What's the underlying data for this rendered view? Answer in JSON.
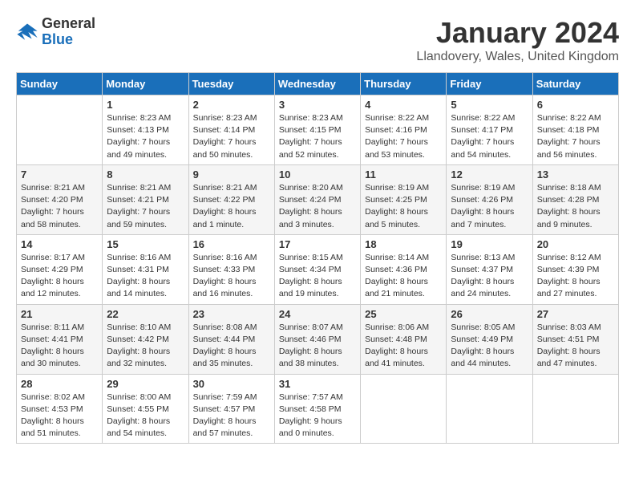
{
  "header": {
    "logo_general": "General",
    "logo_blue": "Blue",
    "month_title": "January 2024",
    "location": "Llandovery, Wales, United Kingdom"
  },
  "days_of_week": [
    "Sunday",
    "Monday",
    "Tuesday",
    "Wednesday",
    "Thursday",
    "Friday",
    "Saturday"
  ],
  "weeks": [
    [
      {
        "day": "",
        "info": ""
      },
      {
        "day": "1",
        "info": "Sunrise: 8:23 AM\nSunset: 4:13 PM\nDaylight: 7 hours\nand 49 minutes."
      },
      {
        "day": "2",
        "info": "Sunrise: 8:23 AM\nSunset: 4:14 PM\nDaylight: 7 hours\nand 50 minutes."
      },
      {
        "day": "3",
        "info": "Sunrise: 8:23 AM\nSunset: 4:15 PM\nDaylight: 7 hours\nand 52 minutes."
      },
      {
        "day": "4",
        "info": "Sunrise: 8:22 AM\nSunset: 4:16 PM\nDaylight: 7 hours\nand 53 minutes."
      },
      {
        "day": "5",
        "info": "Sunrise: 8:22 AM\nSunset: 4:17 PM\nDaylight: 7 hours\nand 54 minutes."
      },
      {
        "day": "6",
        "info": "Sunrise: 8:22 AM\nSunset: 4:18 PM\nDaylight: 7 hours\nand 56 minutes."
      }
    ],
    [
      {
        "day": "7",
        "info": "Sunrise: 8:21 AM\nSunset: 4:20 PM\nDaylight: 7 hours\nand 58 minutes."
      },
      {
        "day": "8",
        "info": "Sunrise: 8:21 AM\nSunset: 4:21 PM\nDaylight: 7 hours\nand 59 minutes."
      },
      {
        "day": "9",
        "info": "Sunrise: 8:21 AM\nSunset: 4:22 PM\nDaylight: 8 hours\nand 1 minute."
      },
      {
        "day": "10",
        "info": "Sunrise: 8:20 AM\nSunset: 4:24 PM\nDaylight: 8 hours\nand 3 minutes."
      },
      {
        "day": "11",
        "info": "Sunrise: 8:19 AM\nSunset: 4:25 PM\nDaylight: 8 hours\nand 5 minutes."
      },
      {
        "day": "12",
        "info": "Sunrise: 8:19 AM\nSunset: 4:26 PM\nDaylight: 8 hours\nand 7 minutes."
      },
      {
        "day": "13",
        "info": "Sunrise: 8:18 AM\nSunset: 4:28 PM\nDaylight: 8 hours\nand 9 minutes."
      }
    ],
    [
      {
        "day": "14",
        "info": "Sunrise: 8:17 AM\nSunset: 4:29 PM\nDaylight: 8 hours\nand 12 minutes."
      },
      {
        "day": "15",
        "info": "Sunrise: 8:16 AM\nSunset: 4:31 PM\nDaylight: 8 hours\nand 14 minutes."
      },
      {
        "day": "16",
        "info": "Sunrise: 8:16 AM\nSunset: 4:33 PM\nDaylight: 8 hours\nand 16 minutes."
      },
      {
        "day": "17",
        "info": "Sunrise: 8:15 AM\nSunset: 4:34 PM\nDaylight: 8 hours\nand 19 minutes."
      },
      {
        "day": "18",
        "info": "Sunrise: 8:14 AM\nSunset: 4:36 PM\nDaylight: 8 hours\nand 21 minutes."
      },
      {
        "day": "19",
        "info": "Sunrise: 8:13 AM\nSunset: 4:37 PM\nDaylight: 8 hours\nand 24 minutes."
      },
      {
        "day": "20",
        "info": "Sunrise: 8:12 AM\nSunset: 4:39 PM\nDaylight: 8 hours\nand 27 minutes."
      }
    ],
    [
      {
        "day": "21",
        "info": "Sunrise: 8:11 AM\nSunset: 4:41 PM\nDaylight: 8 hours\nand 30 minutes."
      },
      {
        "day": "22",
        "info": "Sunrise: 8:10 AM\nSunset: 4:42 PM\nDaylight: 8 hours\nand 32 minutes."
      },
      {
        "day": "23",
        "info": "Sunrise: 8:08 AM\nSunset: 4:44 PM\nDaylight: 8 hours\nand 35 minutes."
      },
      {
        "day": "24",
        "info": "Sunrise: 8:07 AM\nSunset: 4:46 PM\nDaylight: 8 hours\nand 38 minutes."
      },
      {
        "day": "25",
        "info": "Sunrise: 8:06 AM\nSunset: 4:48 PM\nDaylight: 8 hours\nand 41 minutes."
      },
      {
        "day": "26",
        "info": "Sunrise: 8:05 AM\nSunset: 4:49 PM\nDaylight: 8 hours\nand 44 minutes."
      },
      {
        "day": "27",
        "info": "Sunrise: 8:03 AM\nSunset: 4:51 PM\nDaylight: 8 hours\nand 47 minutes."
      }
    ],
    [
      {
        "day": "28",
        "info": "Sunrise: 8:02 AM\nSunset: 4:53 PM\nDaylight: 8 hours\nand 51 minutes."
      },
      {
        "day": "29",
        "info": "Sunrise: 8:00 AM\nSunset: 4:55 PM\nDaylight: 8 hours\nand 54 minutes."
      },
      {
        "day": "30",
        "info": "Sunrise: 7:59 AM\nSunset: 4:57 PM\nDaylight: 8 hours\nand 57 minutes."
      },
      {
        "day": "31",
        "info": "Sunrise: 7:57 AM\nSunset: 4:58 PM\nDaylight: 9 hours\nand 0 minutes."
      },
      {
        "day": "",
        "info": ""
      },
      {
        "day": "",
        "info": ""
      },
      {
        "day": "",
        "info": ""
      }
    ]
  ]
}
